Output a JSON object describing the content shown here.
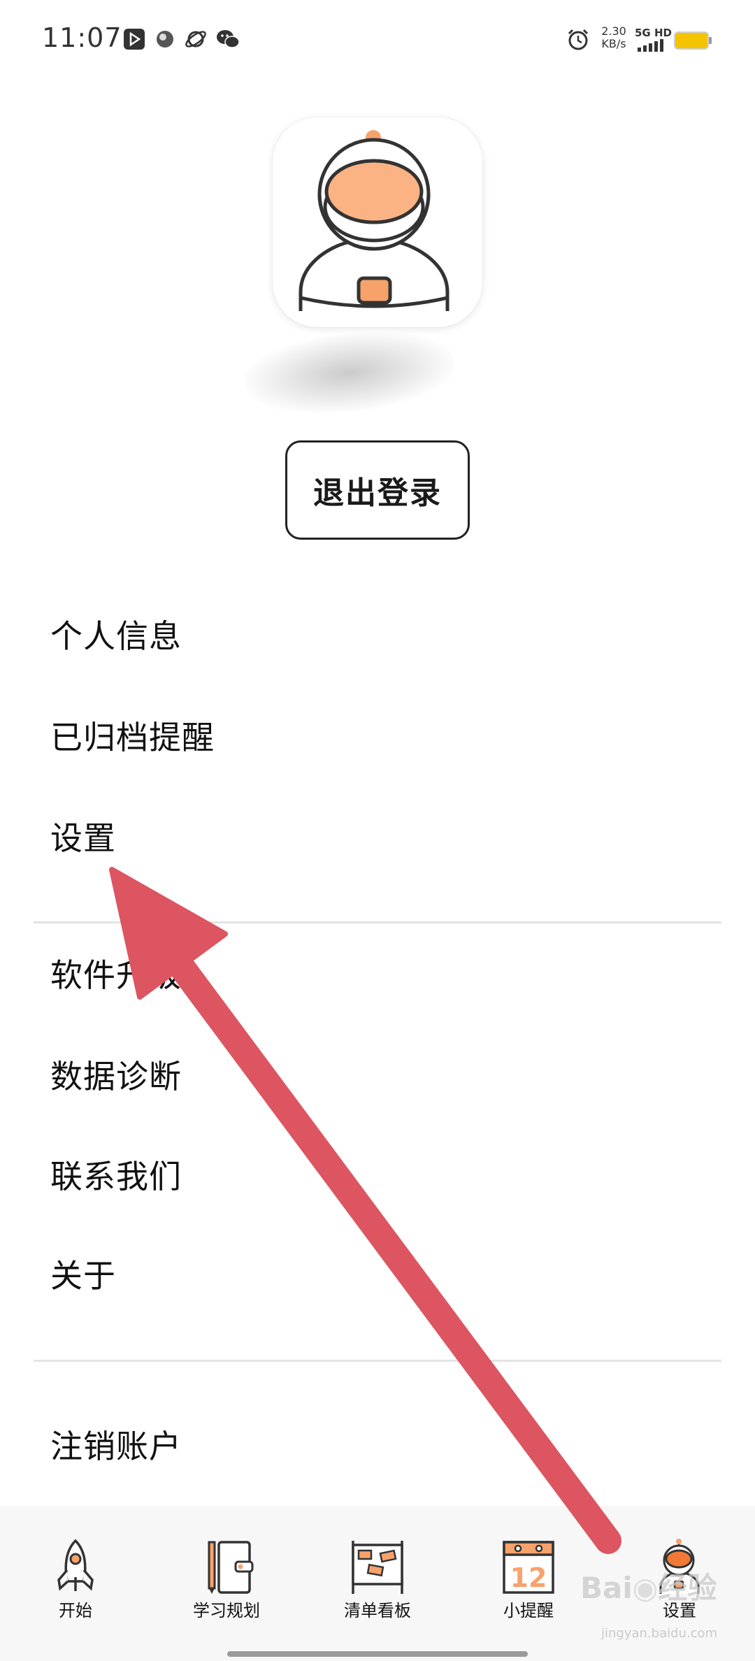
{
  "status_bar": {
    "time": "11:07",
    "net_speed_value": "2.30",
    "net_speed_unit": "KB/s",
    "network_type": "5G HD",
    "app_icons": [
      "video-app-icon",
      "browser-app-icon",
      "planet-app-icon",
      "wechat-icon"
    ]
  },
  "profile": {
    "avatar_icon": "astronaut-avatar-icon",
    "logout_label": "退出登录"
  },
  "menu": {
    "group1": [
      "个人信息",
      "已归档提醒",
      "设置"
    ],
    "group2": [
      "软件升级",
      "数据诊断",
      "联系我们",
      "关于"
    ],
    "group3": [
      "注销账户"
    ]
  },
  "bottom_nav": {
    "items": [
      {
        "label": "开始",
        "icon": "rocket-icon"
      },
      {
        "label": "学习规划",
        "icon": "notebook-pencil-icon"
      },
      {
        "label": "清单看板",
        "icon": "kanban-board-icon"
      },
      {
        "label": "小提醒",
        "icon": "calendar-icon",
        "icon_text": "12"
      },
      {
        "label": "设置",
        "icon": "astronaut-icon"
      }
    ]
  },
  "watermark": {
    "text": "Bai du 经验",
    "sub": "jingyan.baidu.com"
  },
  "colors": {
    "accent_orange": "#f7a26b",
    "arrow_red": "#dc5560",
    "battery_yellow": "#f5c400"
  }
}
